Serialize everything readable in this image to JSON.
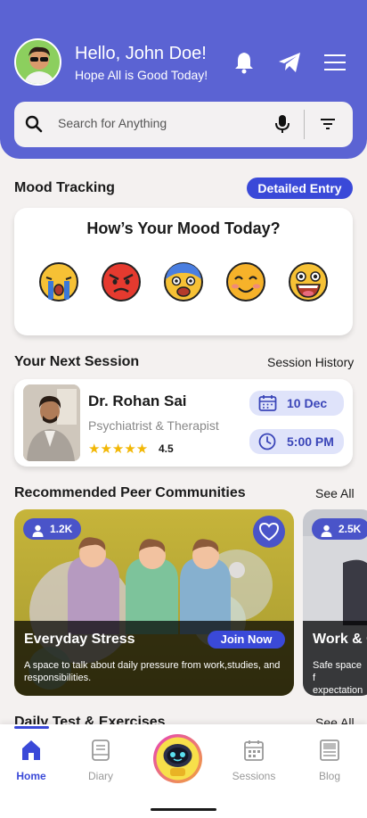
{
  "header": {
    "greeting": "Hello, John Doe!",
    "subtitle": "Hope All is Good Today!",
    "icons": [
      "bell-icon",
      "send-icon",
      "menu-icon"
    ],
    "background_color": "#5b63d3"
  },
  "search": {
    "placeholder": "Search for Anything",
    "icons": [
      "search-icon",
      "microphone-icon",
      "filter-icon"
    ]
  },
  "mood": {
    "section_title": "Mood Tracking",
    "action_label": "Detailed Entry",
    "question": "How’s Your Mood Today?",
    "options": [
      "crying",
      "angry",
      "scared",
      "smiling",
      "grinning"
    ]
  },
  "session": {
    "section_title": "Your Next Session",
    "link_label": "Session History",
    "doctor_name": "Dr. Rohan Sai",
    "doctor_role": "Psychiatrist & Therapist",
    "stars": "★★★★★",
    "rating": "4.5",
    "date": "10 Dec",
    "time": "5:00 PM"
  },
  "communities": {
    "section_title": "Recommended Peer Communities",
    "link_label": "See All",
    "items": [
      {
        "members": "1.2K",
        "title": "Everyday Stress",
        "description": "A space to talk about daily pressure from work,studies, and responsibilities.",
        "join_label": "Join Now"
      },
      {
        "members": "2.5K",
        "title": "Work & C",
        "description": "Safe space f expectation"
      }
    ]
  },
  "exercises": {
    "section_title": "Daily Test & Exercises",
    "link_label": "See All"
  },
  "nav": {
    "items": [
      {
        "label": "Home",
        "icon": "home-icon"
      },
      {
        "label": "Diary",
        "icon": "diary-icon"
      },
      {
        "label": "",
        "icon": "robot-assistant-icon"
      },
      {
        "label": "Sessions",
        "icon": "calendar-icon"
      },
      {
        "label": "Blog",
        "icon": "blog-icon"
      }
    ],
    "accent_color": "#3a49d8"
  }
}
